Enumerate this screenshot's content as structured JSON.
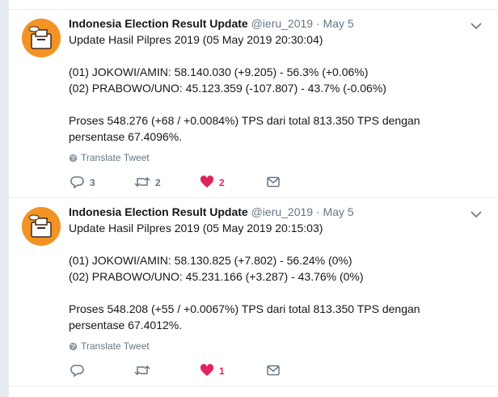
{
  "tweets": [
    {
      "fullname": "Indonesia Election Result Update",
      "handle": "@ieru_2019",
      "separator": "·",
      "time": "May 5",
      "lines": [
        "Update Hasil Pilpres 2019 (05 May 2019 20:30:04)",
        "",
        "(01) JOKOWI/AMIN: 58.140.030 (+9.205) - 56.3% (+0.06%)",
        "(02) PRABOWO/UNO: 45.123.359 (-107.807) - 43.7% (-0.06%)",
        "",
        "Proses 548.276 (+68 / +0.0084%) TPS dari total 813.350 TPS dengan",
        "persentase 67.4096%."
      ],
      "translate_label": "Translate Tweet",
      "reply_count": "3",
      "retweet_count": "2",
      "like_count": "2"
    },
    {
      "fullname": "Indonesia Election Result Update",
      "handle": "@ieru_2019",
      "separator": "·",
      "time": "May 5",
      "lines": [
        "Update Hasil Pilpres 2019 (05 May 2019 20:15:03)",
        "",
        "(01) JOKOWI/AMIN: 58.130.825 (+7.802) - 56.24% (0%)",
        "(02) PRABOWO/UNO: 45.231.166 (+3.287) - 43.76% (0%)",
        "",
        "Proses 548.208 (+55 / +0.0067%) TPS dari total 813.350 TPS dengan",
        "persentase 67.4012%."
      ],
      "translate_label": "Translate Tweet",
      "reply_count": "",
      "retweet_count": "",
      "like_count": "1"
    }
  ],
  "colors": {
    "accent_like": "#e0245e",
    "avatar_bg": "#f39325",
    "muted": "#657786"
  },
  "icons": {
    "reply": "reply-icon",
    "retweet": "retweet-icon",
    "like": "heart-icon",
    "dm": "envelope-icon",
    "translate": "globe-icon",
    "menu": "chevron-down-icon"
  }
}
